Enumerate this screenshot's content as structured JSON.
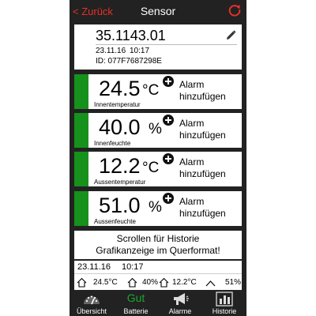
{
  "header": {
    "back_label": "< Zurück",
    "title": "Sensor",
    "refresh_icon": "refresh-icon"
  },
  "sensor": {
    "id_value": "35.1143.01",
    "date": "23.11.16",
    "time": "10:17",
    "device_id": "ID: 077F7687298E",
    "edit_icon": "pencil-icon"
  },
  "measurements": [
    {
      "value": "24.5",
      "unit": "°C",
      "label": "Innentemperatur",
      "alarm_line1": "Alarm",
      "alarm_line2": "hinzufügen"
    },
    {
      "value": "40.0",
      "unit": "%",
      "label": "Innenfeuchte",
      "alarm_line1": "Alarm",
      "alarm_line2": "hinzufügen"
    },
    {
      "value": "12.2",
      "unit": "°C",
      "label": "Aussentemperatur",
      "alarm_line1": "Alarm",
      "alarm_line2": "hinzufügen"
    },
    {
      "value": "51.0",
      "unit": "%",
      "label": "Aussenfeuchte",
      "alarm_line1": "Alarm",
      "alarm_line2": "hinzufügen"
    }
  ],
  "hint": {
    "line1": "Scrollen für Historie",
    "line2": "Grafikanzeige im Querformat!"
  },
  "summary": {
    "date": "23.11.16",
    "time": "10:17",
    "indoor_temp": "24.5°C",
    "indoor_humidity": "40%",
    "outdoor_temp": "12.2°C",
    "outdoor_humidity": "51%"
  },
  "tabs": [
    {
      "label": "Übersicht",
      "icon": "gauge-icon"
    },
    {
      "label": "Batterie",
      "status": "Gut",
      "icon": "battery-status-text"
    },
    {
      "label": "Alarme",
      "icon": "megaphone-icon"
    },
    {
      "label": "Historie",
      "icon": "bar-chart-icon"
    }
  ],
  "colors": {
    "accent_red": "#e53027",
    "status_green": "#16911c",
    "background": "#222222",
    "battery_good": "#1ca62e"
  }
}
